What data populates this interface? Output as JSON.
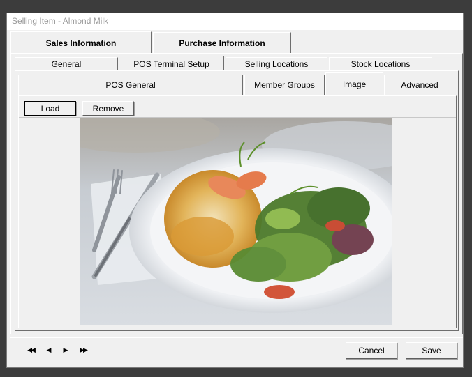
{
  "window": {
    "title": "Selling Item - Almond Milk"
  },
  "top_tabs": [
    {
      "label": "Sales Information",
      "active": true
    },
    {
      "label": "Purchase Information",
      "active": false
    }
  ],
  "second_tabs": [
    {
      "label": "General",
      "active": false
    },
    {
      "label": "POS Terminal Setup",
      "active": true
    },
    {
      "label": "Selling Locations",
      "active": false
    },
    {
      "label": "Stock Locations",
      "active": false
    }
  ],
  "third_tabs": [
    {
      "label": "POS General",
      "active": false
    },
    {
      "label": "Member Groups",
      "active": false
    },
    {
      "label": "Image",
      "active": true
    },
    {
      "label": "Advanced",
      "active": false
    }
  ],
  "image_toolbar": {
    "load_label": "Load",
    "remove_label": "Remove"
  },
  "navigator": {
    "first_icon": "first-record-icon",
    "prev_icon": "previous-record-icon",
    "next_icon": "next-record-icon",
    "last_icon": "last-record-icon"
  },
  "footer": {
    "cancel_label": "Cancel",
    "save_label": "Save"
  }
}
